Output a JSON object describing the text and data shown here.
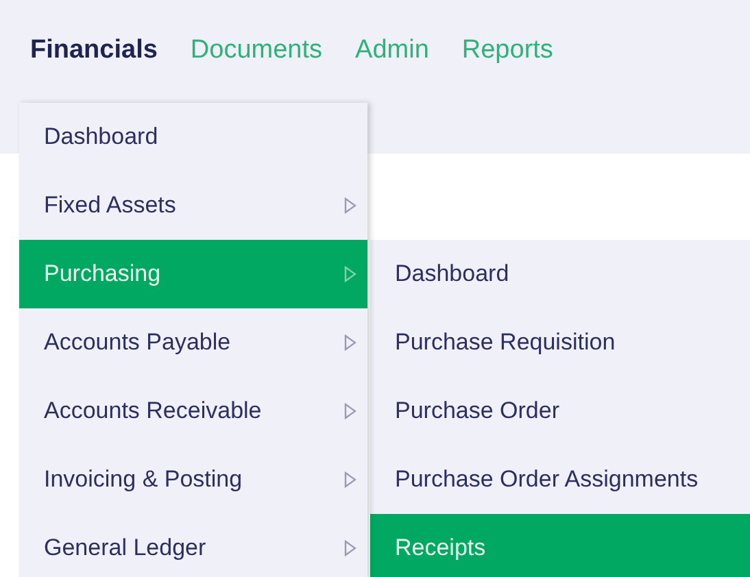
{
  "nav": {
    "tabs": [
      {
        "label": "Financials",
        "selected": true
      },
      {
        "label": "Documents",
        "selected": false
      },
      {
        "label": "Admin",
        "selected": false
      },
      {
        "label": "Reports",
        "selected": false
      }
    ]
  },
  "menu": {
    "items": [
      {
        "label": "Dashboard",
        "selected": false,
        "has_submenu": false
      },
      {
        "label": "Fixed Assets",
        "selected": false,
        "has_submenu": true
      },
      {
        "label": "Purchasing",
        "selected": true,
        "has_submenu": true
      },
      {
        "label": "Accounts Payable",
        "selected": false,
        "has_submenu": true
      },
      {
        "label": "Accounts Receivable",
        "selected": false,
        "has_submenu": true
      },
      {
        "label": "Invoicing & Posting",
        "selected": false,
        "has_submenu": true
      },
      {
        "label": "General Ledger",
        "selected": false,
        "has_submenu": true
      }
    ]
  },
  "submenu": {
    "items": [
      {
        "label": "Dashboard",
        "selected": false
      },
      {
        "label": "Purchase Requisition",
        "selected": false
      },
      {
        "label": "Purchase Order",
        "selected": false
      },
      {
        "label": "Purchase Order Assignments",
        "selected": false
      },
      {
        "label": "Receipts",
        "selected": true
      }
    ]
  }
}
